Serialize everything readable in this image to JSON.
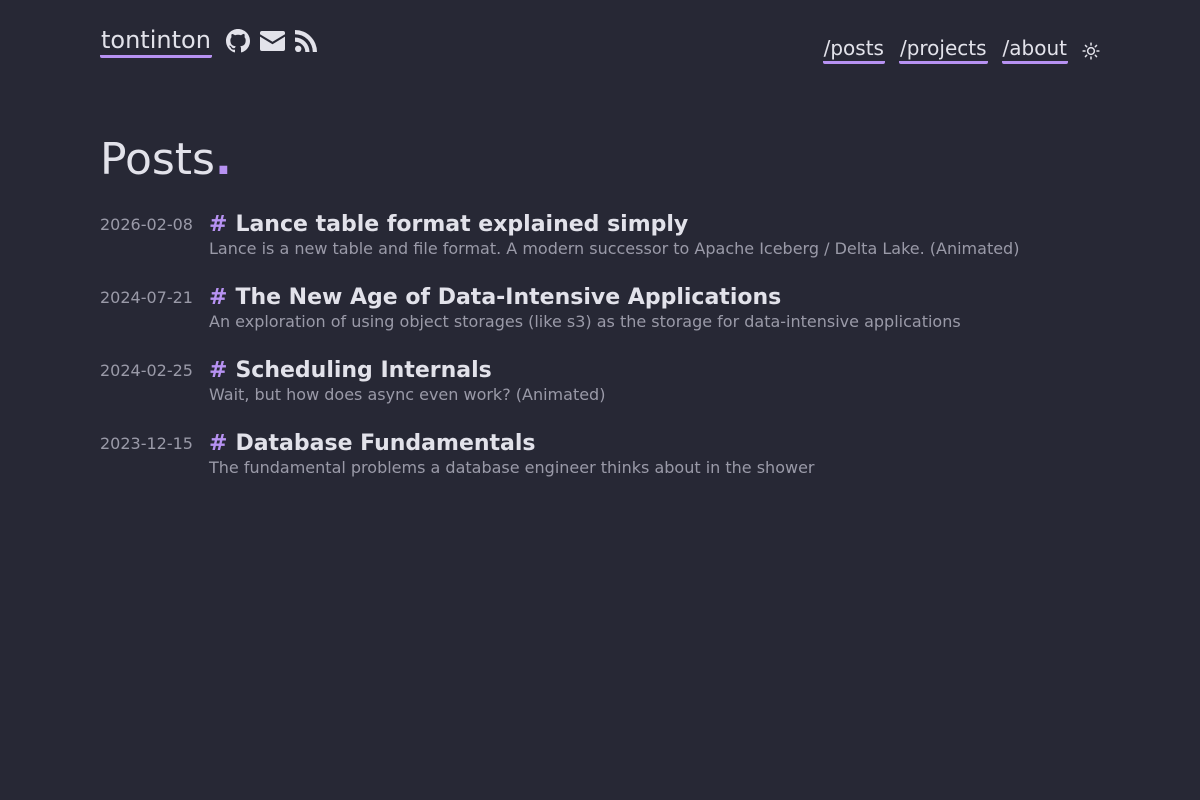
{
  "header": {
    "site_name": "tontinton",
    "socials": [
      {
        "icon": "github-icon"
      },
      {
        "icon": "mail-icon"
      },
      {
        "icon": "rss-icon"
      }
    ],
    "nav": [
      {
        "label": "/posts"
      },
      {
        "label": "/projects"
      },
      {
        "label": "/about"
      }
    ],
    "theme_toggle_icon": "sun-icon"
  },
  "main": {
    "title": "Posts",
    "title_dot": ".",
    "posts": [
      {
        "date": "2026-02-08",
        "hash": "#",
        "title": "Lance table format explained simply",
        "description": "Lance is a new table and file format. A modern successor to Apache Iceberg / Delta Lake. (Animated)"
      },
      {
        "date": "2024-07-21",
        "hash": "#",
        "title": "The New Age of Data-Intensive Applications",
        "description": "An exploration of using object storages (like s3) as the storage for data-intensive applications"
      },
      {
        "date": "2024-02-25",
        "hash": "#",
        "title": "Scheduling Internals",
        "description": "Wait, but how does async even work? (Animated)"
      },
      {
        "date": "2023-12-15",
        "hash": "#",
        "title": "Database Fundamentals",
        "description": "The fundamental problems a database engineer thinks about in the shower"
      }
    ]
  },
  "colors": {
    "background": "#272835",
    "text": "#e2e2ea",
    "muted": "#9a9aa8",
    "accent": "#b792f2"
  }
}
